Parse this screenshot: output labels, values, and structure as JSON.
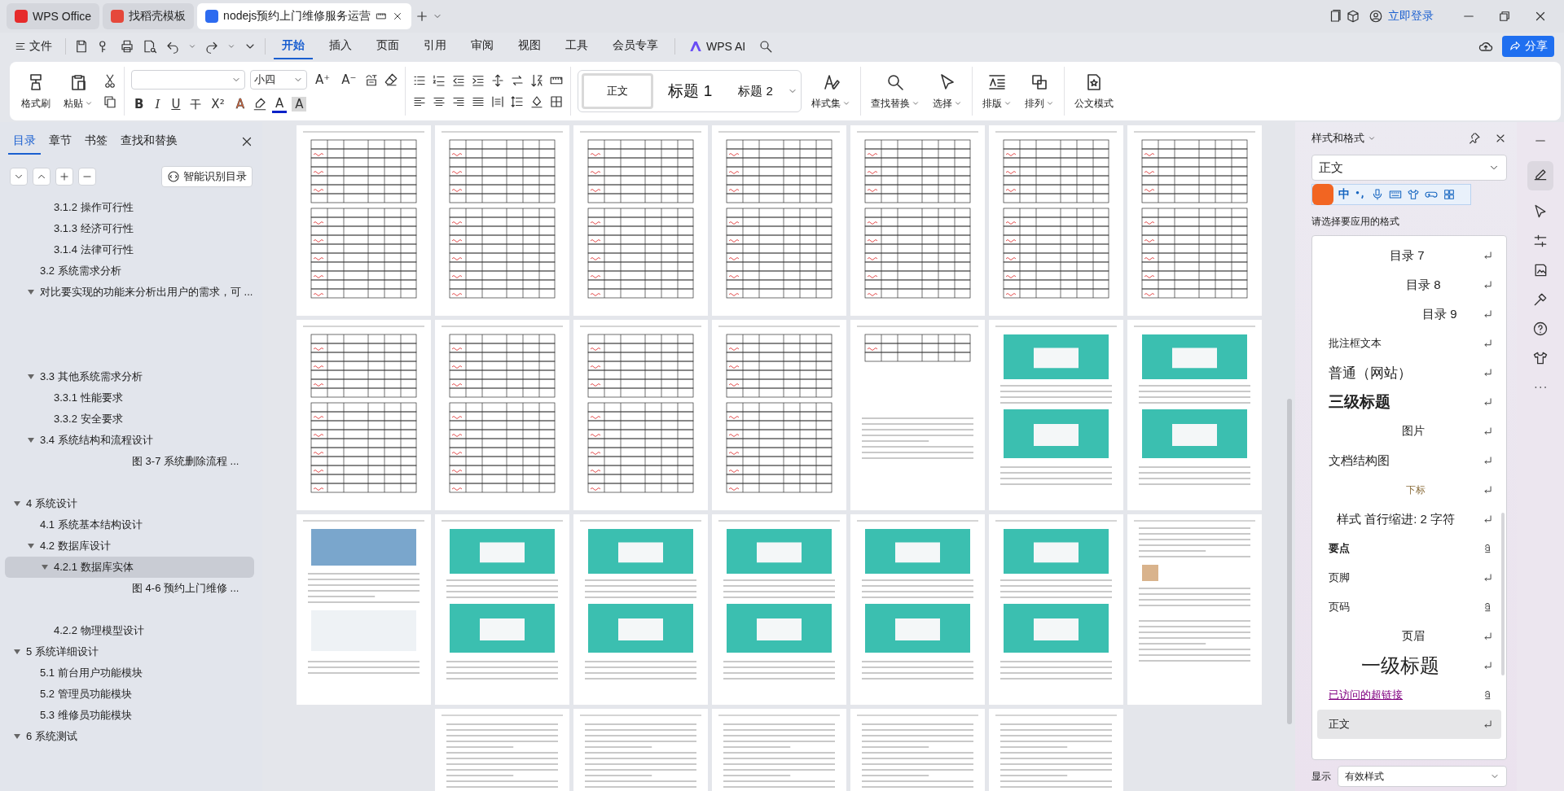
{
  "tabs": [
    {
      "label": "WPS Office",
      "kind": "wps",
      "selected": false
    },
    {
      "label": "找稻壳模板",
      "kind": "docer",
      "selected": false
    },
    {
      "label": "nodejs预约上门维修服务运营",
      "kind": "writer",
      "selected": true
    }
  ],
  "account": {
    "login": "立即登录"
  },
  "menu": {
    "file": "文件",
    "tabs": [
      {
        "label": "开始",
        "selected": true
      },
      {
        "label": "插入",
        "selected": false
      },
      {
        "label": "页面",
        "selected": false
      },
      {
        "label": "引用",
        "selected": false
      },
      {
        "label": "审阅",
        "selected": false
      },
      {
        "label": "视图",
        "selected": false
      },
      {
        "label": "工具",
        "selected": false
      },
      {
        "label": "会员专享",
        "selected": false
      }
    ],
    "ai": "WPS AI",
    "share": "分享"
  },
  "ribbon": {
    "format_painter": "格式刷",
    "paste": "粘贴",
    "font_size": "小四",
    "size_buttons": [
      "A⁺",
      "A⁻"
    ],
    "font_buttons": [
      {
        "glyph": "B",
        "kind": "bold"
      },
      {
        "glyph": "I",
        "kind": "italic"
      },
      {
        "glyph": "U",
        "kind": "underline"
      },
      {
        "glyph": "X²",
        "kind": "plain"
      },
      {
        "glyph": "A",
        "kind": "effect"
      },
      {
        "glyph": "A",
        "kind": "color"
      },
      {
        "glyph": "A",
        "kind": "shade"
      }
    ],
    "styles": [
      {
        "label": "正文",
        "kind": "body",
        "selected": true
      },
      {
        "label": "标题  1",
        "kind": "h1",
        "selected": false
      },
      {
        "label": "标题  2",
        "kind": "h2",
        "selected": false
      }
    ],
    "style_set": "样式集",
    "find": "查找替换",
    "select": "选择",
    "layout": "排版",
    "arrange": "排列",
    "official": "公文模式"
  },
  "nav_panel": {
    "tabs": [
      {
        "label": "目录",
        "selected": true
      },
      {
        "label": "章节",
        "selected": false
      },
      {
        "label": "书签",
        "selected": false
      },
      {
        "label": "查找和替换",
        "selected": false
      }
    ],
    "smart_toc": "智能识别目录",
    "outline": [
      {
        "children": [
          {
            "children": [
              {
                "text": "3.1.2  操作可行性"
              },
              {
                "text": "3.1.3  经济可行性"
              },
              {
                "text": "3.1.4  法律可行性"
              }
            ]
          },
          {
            "text": "3.2 系统需求分析"
          },
          {
            "text": "对比要实现的功能来分析出用户的需求，可 ...",
            "expanded": true
          },
          {
            "text": "3.3 其他系统需求分析",
            "expanded": true,
            "children": [
              {
                "text": "3.3.1 性能要求"
              },
              {
                "text": "3.3.2 安全要求"
              }
            ]
          },
          {
            "text": "3.4    系统结构和流程设计",
            "expanded": true,
            "children": [
              {
                "text": "图 3-7 系统删除流程 ...",
                "kind": "figure"
              }
            ]
          }
        ]
      },
      {
        "text": "4 系统设计",
        "expanded": true,
        "children": [
          {
            "text": "4.1    系统基本结构设计"
          },
          {
            "text": "4.2  数据库设计",
            "expanded": true,
            "children": [
              {
                "text": "4.2.1  数据库实体",
                "expanded": true,
                "selected": true,
                "children": [
                  {
                    "text": "图 4-6 预约上门维修 ...",
                    "kind": "figure"
                  }
                ]
              },
              {
                "text": "4.2.2  物理模型设计"
              }
            ]
          }
        ]
      },
      {
        "text": "5 系统详细设计",
        "expanded": true,
        "children": [
          {
            "text": "5.1  前台用户功能模块"
          },
          {
            "text": "5.2  管理员功能模块"
          },
          {
            "text": "5.3  维修员功能模块"
          }
        ]
      },
      {
        "text": "6 系统测试",
        "expanded": true
      }
    ]
  },
  "pages": [
    {
      "kind": "tables"
    },
    {
      "kind": "tables"
    },
    {
      "kind": "tables"
    },
    {
      "kind": "tables"
    },
    {
      "kind": "tables"
    },
    {
      "kind": "tables"
    },
    {
      "kind": "tables"
    },
    {
      "kind": "tables"
    },
    {
      "kind": "tables"
    },
    {
      "kind": "tables"
    },
    {
      "kind": "tables"
    },
    {
      "kind": "table-text"
    },
    {
      "kind": "screens"
    },
    {
      "kind": "screens"
    },
    {
      "kind": "photo-text"
    },
    {
      "kind": "screens"
    },
    {
      "kind": "screens"
    },
    {
      "kind": "screens"
    },
    {
      "kind": "screens"
    },
    {
      "kind": "screens"
    },
    {
      "kind": "text-screen"
    },
    {
      "kind": "text"
    },
    {
      "kind": "text"
    },
    {
      "kind": "text"
    },
    {
      "kind": "text"
    },
    {
      "kind": "text"
    }
  ],
  "styles_panel": {
    "title": "样式和格式",
    "current": "正文",
    "ime": "中",
    "prompt": "请选择要应用的格式",
    "items": [
      {
        "text": "目录  7",
        "kind": "toc7",
        "character": false,
        "selected": false
      },
      {
        "text": "目录  8",
        "kind": "toc8",
        "character": false,
        "selected": false
      },
      {
        "text": "目录  9",
        "kind": "toc9",
        "character": false,
        "selected": false
      },
      {
        "text": "批注框文本",
        "kind": "small",
        "character": false,
        "selected": false
      },
      {
        "text": "普通（网站）",
        "kind": "web",
        "character": false,
        "selected": false
      },
      {
        "text": "三级标题",
        "kind": "h3",
        "character": false,
        "selected": false
      },
      {
        "text": "图片",
        "kind": "center",
        "character": false,
        "selected": false
      },
      {
        "text": "文档结构图",
        "kind": "map",
        "character": false,
        "selected": false
      },
      {
        "text": "下标",
        "kind": "sub",
        "character": false,
        "selected": false
      },
      {
        "text": "样式  首行缩进:   2  字符",
        "kind": "indent",
        "character": false,
        "selected": false
      },
      {
        "text": "要点",
        "kind": "bold",
        "character": true,
        "selected": false
      },
      {
        "text": "页脚",
        "kind": "plain",
        "character": false,
        "selected": false
      },
      {
        "text": "页码",
        "kind": "plain",
        "character": true,
        "selected": false
      },
      {
        "text": "页眉",
        "kind": "center",
        "character": false,
        "selected": false
      },
      {
        "text": "一级标题",
        "kind": "h1",
        "character": false,
        "selected": false
      },
      {
        "text": "已访问的超链接",
        "kind": "visited",
        "character": true,
        "selected": false
      },
      {
        "text": "正文",
        "kind": "plain",
        "character": false,
        "selected": true
      }
    ],
    "show_label": "显示",
    "show_value": "有效样式"
  }
}
